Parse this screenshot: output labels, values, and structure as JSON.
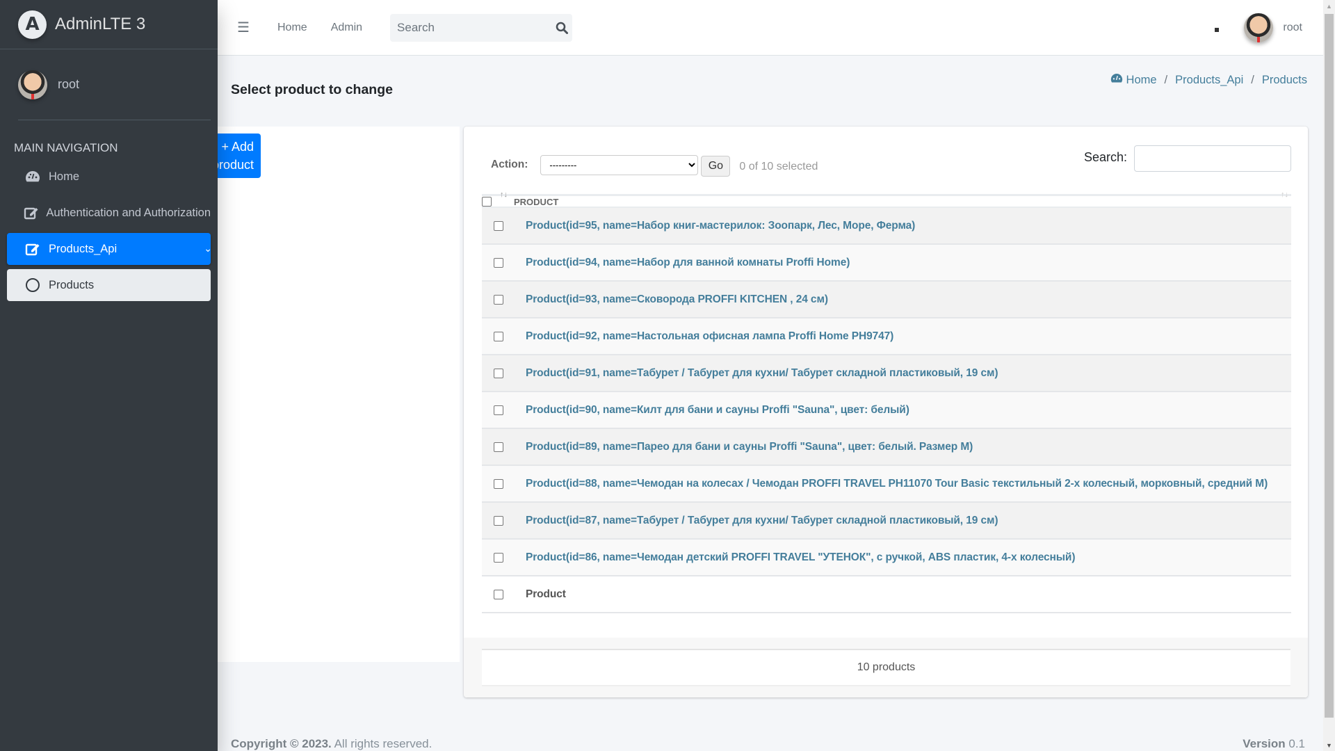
{
  "brand": {
    "name": "AdminLTE 3",
    "logo_letter": "A"
  },
  "sidebar": {
    "user": "root",
    "nav_header": "MAIN NAVIGATION",
    "items": [
      {
        "label": "Home",
        "icon": "dashboard-icon"
      },
      {
        "label": "Authentication and Authorization",
        "icon": "edit-icon"
      },
      {
        "label": "Products_Api",
        "icon": "edit-icon",
        "active": true
      },
      {
        "label": "Products",
        "icon": "circle-icon",
        "sub": true
      }
    ]
  },
  "navbar": {
    "menu_icon": "hamburger-icon",
    "links": [
      "Home",
      "Admin"
    ],
    "search_placeholder": "Search",
    "user": "root"
  },
  "page": {
    "title": "Select product to change",
    "breadcrumb": [
      "Home",
      "Products_Api",
      "Products"
    ],
    "add_button": "+ Add product"
  },
  "changelist": {
    "action_label": "Action:",
    "action_selected": "---------",
    "go_label": "Go",
    "selected_count": "0 of 10 selected",
    "search_label": "Search:",
    "search_value": "",
    "column_header": "PRODUCT",
    "rows": [
      "Product(id=95, name=Набор книг-мастерилок: Зоопарк, Лес, Море, Ферма)",
      "Product(id=94, name=Набор для ванной комнаты Proffi Home)",
      "Product(id=93, name=Сковорода PROFFI KITCHEN , 24 см)",
      "Product(id=92, name=Настольная офисная лампа Proffi Home PH9747)",
      "Product(id=91, name=Табурет / Табурет для кухни/ Табурет складной пластиковый, 19 см)",
      "Product(id=90, name=Килт для бани и сауны Proffi \"Sauna\", цвет: белый)",
      "Product(id=89, name=Парео для бани и сауны Proffi \"Sauna\", цвет: белый. Размер M)",
      "Product(id=88, name=Чемодан на колесах / Чемодан PROFFI TRAVEL PH11070 Tour Basic текстильный 2-х колесный, морковный, средний M)",
      "Product(id=87, name=Табурет / Табурет для кухни/ Табурет складной пластиковый, 19 см)",
      "Product(id=86, name=Чемодан детский PROFFI TRAVEL \"УТЕНОК\", с ручкой, ABS пластик, 4-х колесный)"
    ],
    "total_row_label": "Product",
    "paginator": "10 products"
  },
  "footer": {
    "copyright_bold": "Copyright © 2023.",
    "copyright_rest": " All rights reserved.",
    "version_label": "Version",
    "version_value": " 0.1"
  },
  "colors": {
    "sidebar_bg": "#343a40",
    "primary": "#007bff",
    "link": "#447e9b"
  }
}
